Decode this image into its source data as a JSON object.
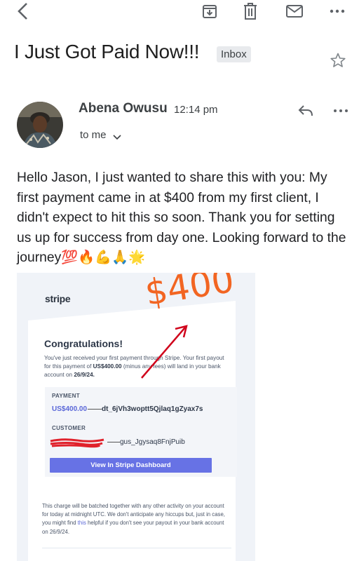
{
  "toolbar": {
    "back_icon": "arrow-back-icon",
    "archive_icon": "archive-icon",
    "delete_icon": "trash-icon",
    "mail_icon": "mail-icon",
    "more_icon": "more-horizontal-icon"
  },
  "email": {
    "subject": "I Just Got Paid Now!!!",
    "label": "Inbox",
    "sender_name": "Abena Owusu",
    "time": "12:14 pm",
    "to_me": "to me",
    "body": "Hello Jason, I just wanted to share this with you: My first payment came in at $400 from my first client, I didn't expect to hit this so soon. Thank you for setting us up for success from day one. Looking forward to the journey💯🔥💪🙏🌟"
  },
  "stripe": {
    "logo": "stripe",
    "big_amount": "$400",
    "congrats": "Congratulations!",
    "intro_1": "You've just received your first payment through Stripe. Your first payout for this payment of ",
    "intro_amount": "US$400.00",
    "intro_2": " (minus any fees) will land in your bank account on ",
    "intro_date": "26/9/24.",
    "payment_heading": "PAYMENT",
    "payment_amount": "US$400.00",
    "payment_id": "dt_6jVh3woptt5Qjlaq1gZyax7s",
    "customer_heading": "CUSTOMER",
    "customer_id": "gus_Jgysaq8FnjPuib",
    "dashboard_button": "View In Stripe Dashboard",
    "batch_1": "This charge will be batched together with any other activity on your account for today at midnight UTC. We don't anticipate any hiccups but, just in case, you might find ",
    "batch_link": "this",
    "batch_2": " helpful if you don't see your payout in your bank account on 26/9/24.",
    "accent_color": "#6772e5",
    "annotation_color": "#f26522"
  }
}
